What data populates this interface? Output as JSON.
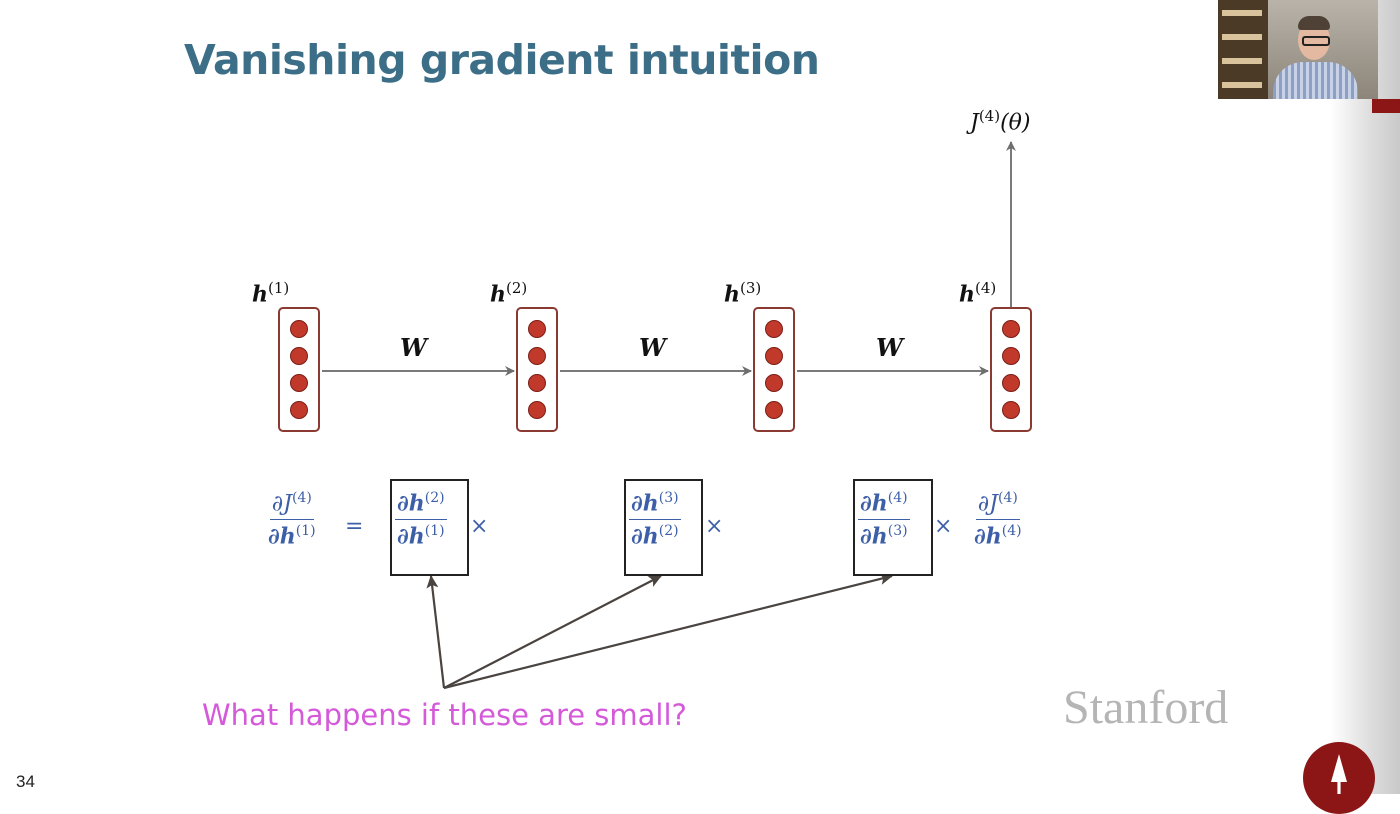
{
  "slide": {
    "title": "Vanishing gradient intuition",
    "question": "What happens if these are small?",
    "institution": "Stanford",
    "slide_number": "34"
  },
  "diagram": {
    "hidden_states": [
      {
        "base": "h",
        "sup": "(1)"
      },
      {
        "base": "h",
        "sup": "(2)"
      },
      {
        "base": "h",
        "sup": "(3)"
      },
      {
        "base": "h",
        "sup": "(4)"
      }
    ],
    "weight_label": "W",
    "loss": {
      "base": "J",
      "sup": "(4)",
      "arg": "(θ)"
    }
  },
  "equation": {
    "lhs": {
      "num_base": "∂J",
      "num_sup": "(4)",
      "den_base": "∂h",
      "den_sup": "(1)"
    },
    "equals": "=",
    "times": "×",
    "factors": [
      {
        "num_base": "∂h",
        "num_sup": "(2)",
        "den_base": "∂h",
        "den_sup": "(1)"
      },
      {
        "num_base": "∂h",
        "num_sup": "(3)",
        "den_base": "∂h",
        "den_sup": "(2)"
      },
      {
        "num_base": "∂h",
        "num_sup": "(4)",
        "den_base": "∂h",
        "den_sup": "(3)"
      }
    ],
    "last": {
      "num_base": "∂J",
      "num_sup": "(4)",
      "den_base": "∂h",
      "den_sup": "(4)"
    }
  },
  "colors": {
    "title": "#3c6e87",
    "equation": "#3d5fa8",
    "question": "#d45ad9",
    "node_fill": "#c0392b",
    "node_border": "#8b3a32",
    "stanford_red": "#8c1515"
  }
}
